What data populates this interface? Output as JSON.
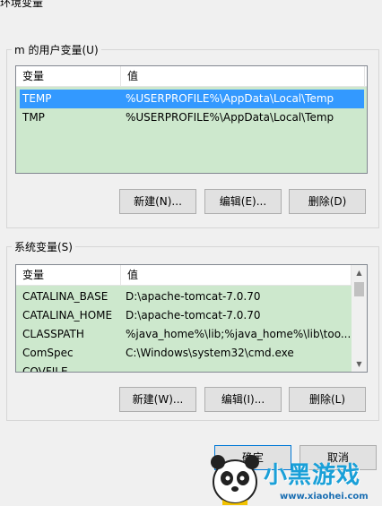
{
  "window": {
    "title": "环境变量"
  },
  "user_vars": {
    "group_title": "m 的用户变量(U)",
    "columns": [
      "变量",
      "值"
    ],
    "rows": [
      {
        "name": "TEMP",
        "value": "%USERPROFILE%\\AppData\\Local\\Temp",
        "selected": true
      },
      {
        "name": "TMP",
        "value": "%USERPROFILE%\\AppData\\Local\\Temp",
        "selected": false
      }
    ],
    "buttons": {
      "new": "新建(N)...",
      "edit": "编辑(E)...",
      "delete": "删除(D)"
    }
  },
  "system_vars": {
    "group_title": "系统变量(S)",
    "columns": [
      "变量",
      "值"
    ],
    "rows": [
      {
        "name": "CATALINA_BASE",
        "value": "D:\\apache-tomcat-7.0.70"
      },
      {
        "name": "CATALINA_HOME",
        "value": "D:\\apache-tomcat-7.0.70"
      },
      {
        "name": "CLASSPATH",
        "value": "%java_home%\\lib;%java_home%\\lib\\too..."
      },
      {
        "name": "ComSpec",
        "value": "C:\\Windows\\system32\\cmd.exe"
      },
      {
        "name": "COVFILE",
        "value": ""
      }
    ],
    "buttons": {
      "new": "新建(W)...",
      "edit": "编辑(I)...",
      "delete": "删除(L)"
    }
  },
  "dialog_buttons": {
    "ok": "确定",
    "cancel": "取消"
  },
  "watermark": {
    "brand": "小黑游戏",
    "url": "www.xiaohei.com"
  },
  "colors": {
    "list_bg": "#cde8cd",
    "selection": "#3399ff",
    "watermark": "#1aa0d8"
  }
}
